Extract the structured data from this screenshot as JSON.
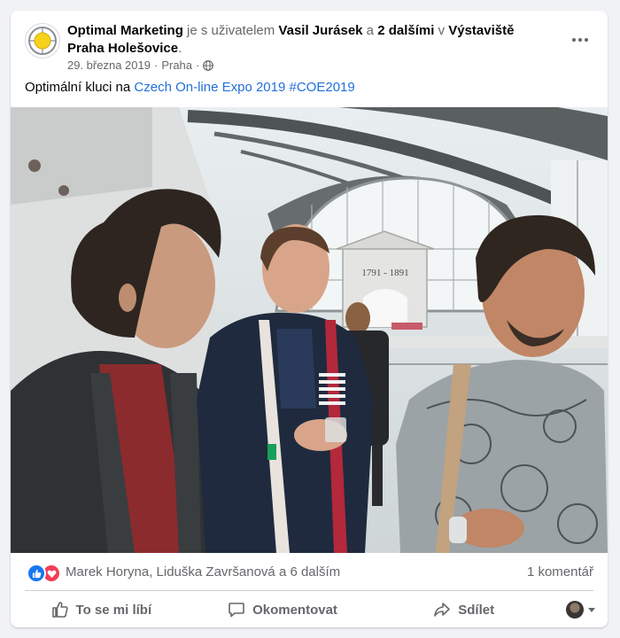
{
  "post": {
    "page_name": "Optimal Marketing",
    "with_text": "je s uživatelem",
    "tagged_user": "Vasil Jurásek",
    "and_text": "a",
    "others": "2 dalšími",
    "in_text": "v",
    "location": "Výstaviště Praha Holešovice",
    "period": ".",
    "date": "29. března 2019",
    "separator": "·",
    "place": "Praha",
    "caption_text": "Optimální kluci na",
    "caption_link": "Czech On-line Expo 2019",
    "hashtag": "#COE2019",
    "photo_sign": "1791 - 1891"
  },
  "reactions": {
    "names": "Marek Horyna, Liduška Završanová a 6 dalším",
    "comments": "1 komentář"
  },
  "actions": {
    "like": "To se mi líbí",
    "comment": "Okomentovat",
    "share": "Sdílet"
  },
  "colors": {
    "link": "#216fdb",
    "like": "#1877f2",
    "love": "#f33e58",
    "secondary_text": "#65676b"
  }
}
